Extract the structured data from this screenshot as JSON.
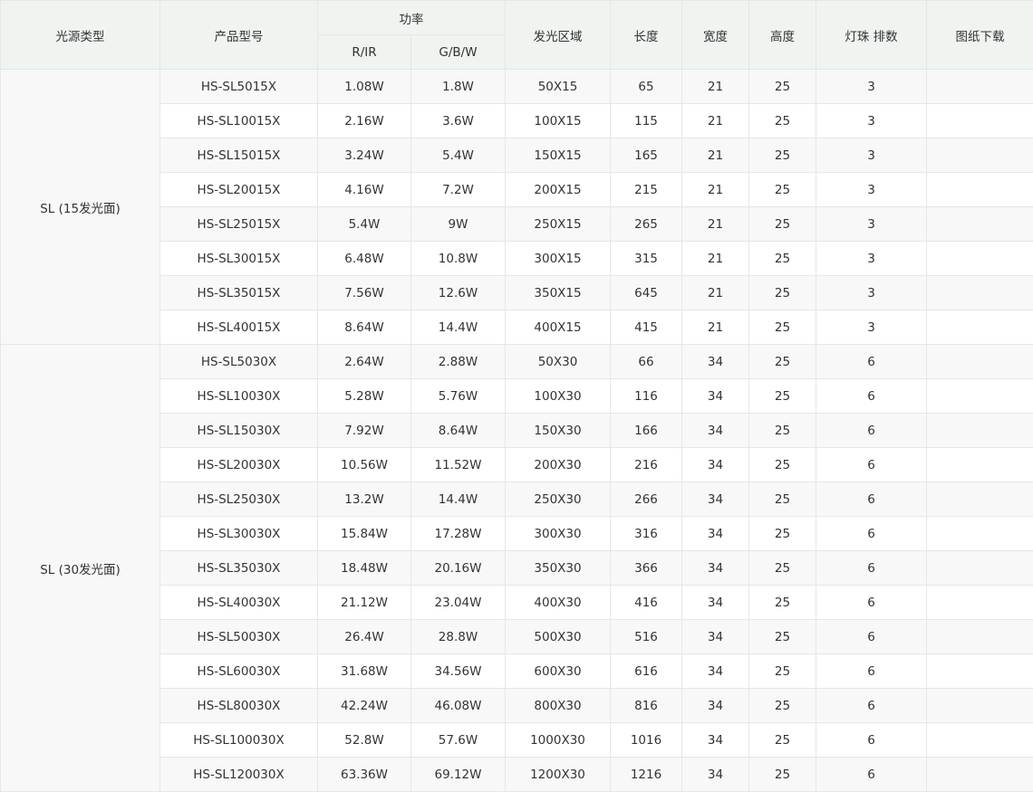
{
  "table": {
    "headers": {
      "light_type": "光源类型",
      "model": "产品型号",
      "power": "功率",
      "power_rir": "R/IR",
      "power_gbw": "G/B/W",
      "area": "发光区域",
      "length": "长度",
      "width": "宽度",
      "height": "高度",
      "led_rows": "灯珠 排数",
      "drawing_download": "图纸下载"
    },
    "groups": [
      {
        "name": "SL (15发光面)",
        "rows": [
          [
            "HS-SL5015X",
            "1.08W",
            "1.8W",
            "50X15",
            "65",
            "21",
            "25",
            "3",
            ""
          ],
          [
            "HS-SL10015X",
            "2.16W",
            "3.6W",
            "100X15",
            "115",
            "21",
            "25",
            "3",
            ""
          ],
          [
            "HS-SL15015X",
            "3.24W",
            "5.4W",
            "150X15",
            "165",
            "21",
            "25",
            "3",
            ""
          ],
          [
            "HS-SL20015X",
            "4.16W",
            "7.2W",
            "200X15",
            "215",
            "21",
            "25",
            "3",
            ""
          ],
          [
            "HS-SL25015X",
            "5.4W",
            "9W",
            "250X15",
            "265",
            "21",
            "25",
            "3",
            ""
          ],
          [
            "HS-SL30015X",
            "6.48W",
            "10.8W",
            "300X15",
            "315",
            "21",
            "25",
            "3",
            ""
          ],
          [
            "HS-SL35015X",
            "7.56W",
            "12.6W",
            "350X15",
            "645",
            "21",
            "25",
            "3",
            ""
          ],
          [
            "HS-SL40015X",
            "8.64W",
            "14.4W",
            "400X15",
            "415",
            "21",
            "25",
            "3",
            ""
          ]
        ]
      },
      {
        "name": "SL (30发光面)",
        "rows": [
          [
            "HS-SL5030X",
            "2.64W",
            "2.88W",
            "50X30",
            "66",
            "34",
            "25",
            "6",
            ""
          ],
          [
            "HS-SL10030X",
            "5.28W",
            "5.76W",
            "100X30",
            "116",
            "34",
            "25",
            "6",
            ""
          ],
          [
            "HS-SL15030X",
            "7.92W",
            "8.64W",
            "150X30",
            "166",
            "34",
            "25",
            "6",
            ""
          ],
          [
            "HS-SL20030X",
            "10.56W",
            "11.52W",
            "200X30",
            "216",
            "34",
            "25",
            "6",
            ""
          ],
          [
            "HS-SL25030X",
            "13.2W",
            "14.4W",
            "250X30",
            "266",
            "34",
            "25",
            "6",
            ""
          ],
          [
            "HS-SL30030X",
            "15.84W",
            "17.28W",
            "300X30",
            "316",
            "34",
            "25",
            "6",
            ""
          ],
          [
            "HS-SL35030X",
            "18.48W",
            "20.16W",
            "350X30",
            "366",
            "34",
            "25",
            "6",
            ""
          ],
          [
            "HS-SL40030X",
            "21.12W",
            "23.04W",
            "400X30",
            "416",
            "34",
            "25",
            "6",
            ""
          ],
          [
            "HS-SL50030X",
            "26.4W",
            "28.8W",
            "500X30",
            "516",
            "34",
            "25",
            "6",
            ""
          ],
          [
            "HS-SL60030X",
            "31.68W",
            "34.56W",
            "600X30",
            "616",
            "34",
            "25",
            "6",
            ""
          ],
          [
            "HS-SL80030X",
            "42.24W",
            "46.08W",
            "800X30",
            "816",
            "34",
            "25",
            "6",
            ""
          ],
          [
            "HS-SL100030X",
            "52.8W",
            "57.6W",
            "1000X30",
            "1016",
            "34",
            "25",
            "6",
            ""
          ],
          [
            "HS-SL120030X",
            "63.36W",
            "69.12W",
            "1200X30",
            "1216",
            "34",
            "25",
            "6",
            ""
          ]
        ]
      }
    ]
  },
  "colors": {
    "header_bg": "#f0f4f1",
    "stripe_bg": "#f7f8f7",
    "border": "#e4e8e4",
    "text": "#333333"
  }
}
